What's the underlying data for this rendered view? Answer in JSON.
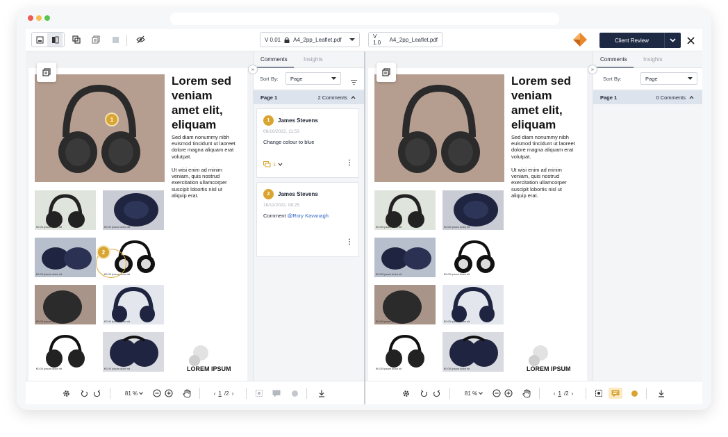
{
  "left": {
    "version": "V 0.01",
    "filename": "A4_2pp_Leaflet.pdf",
    "tabs": {
      "comments": "Comments",
      "insights": "Insights"
    },
    "sort_label": "Sort By:",
    "sort_value": "Page",
    "page_label": "Page 1",
    "comment_count": "2 Comments",
    "comments": [
      {
        "marker": "1",
        "author": "James Stevens",
        "date": "06/10/2022, 11:53",
        "text": "Change colour to blue",
        "mention": "",
        "replies": "1"
      },
      {
        "marker": "2",
        "author": "James Stevens",
        "date": "16/11/2022, 08:25",
        "text": "Comment ",
        "mention": "@Rory Kavanagh",
        "replies": ""
      }
    ],
    "zoom": "81 %",
    "page_current": "1",
    "page_total": "/2"
  },
  "right": {
    "version": "V 1.0",
    "filename": "A4_2pp_Leaflet.pdf",
    "tabs": {
      "comments": "Comments",
      "insights": "Insights"
    },
    "sort_label": "Sort By:",
    "sort_value": "Page",
    "page_label": "Page 1",
    "comment_count": "0 Comments",
    "zoom": "81 %",
    "page_current": "1",
    "page_total": "/2"
  },
  "review_button": "Client Review",
  "document": {
    "title": "Lorem sed veniam amet elit, eliquam",
    "para1": "Sed diam nonummy nibh euismod tincidunt ut laoreet dolore magna aliquam erat volutpat.",
    "para2": "Ut wisi enim ad minim veniam, quis nostrud exercitation ullamcorper suscipit lobortis nisl ut aliquip erat.",
    "caption": "€0.00 Ipsum dolor sit",
    "logo": "LOREM IPSUM"
  },
  "colors": {
    "accent": "#d9a530",
    "navy": "#1e2a44",
    "page_head": "#dde3ed",
    "mention": "#2f66c4"
  }
}
